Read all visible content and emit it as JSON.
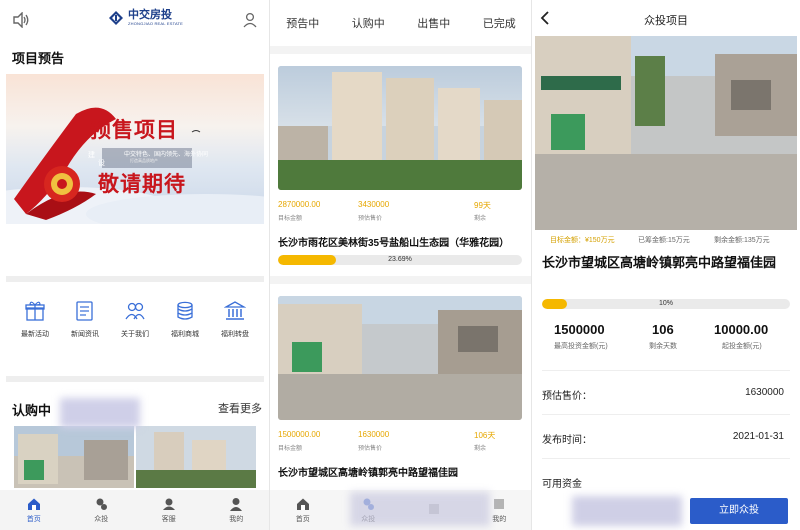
{
  "panel_home": {
    "logo": {
      "name_cn": "中交房投",
      "name_en": "ZHONGJIAO REAL ESTATE"
    },
    "section_preview_title": "项目预告",
    "banner": {
      "headline1": "预售项目",
      "headline2": "敬请期待",
      "badge1": "建",
      "badge2": "设",
      "strip_text": "中交特色、国内领先、海外协同",
      "strip_sub": "打造高品质地产"
    },
    "menu": [
      {
        "label": "最新活动",
        "icon": "gift-icon"
      },
      {
        "label": "新闻资讯",
        "icon": "news-icon"
      },
      {
        "label": "关于我们",
        "icon": "people-icon"
      },
      {
        "label": "福利商城",
        "icon": "coins-icon"
      },
      {
        "label": "福利转盘",
        "icon": "bank-icon"
      }
    ],
    "section_subscribing_title": "认购中",
    "more_label": "查看更多",
    "tabbar": [
      {
        "label": "首页",
        "icon": "home-icon",
        "active": true
      },
      {
        "label": "众投",
        "icon": "invest-icon",
        "active": false
      },
      {
        "label": "客服",
        "icon": "service-icon",
        "active": false
      },
      {
        "label": "我的",
        "icon": "profile-icon",
        "active": false
      }
    ]
  },
  "panel_list": {
    "tabs": [
      "预告中",
      "认购中",
      "出售中",
      "已完成"
    ],
    "cards": [
      {
        "target_amount": "2870000.00",
        "target_label": "目标金额",
        "est_price": "3430000",
        "est_label": "预估售价",
        "days": "99天",
        "days_label": "剩余",
        "title": "长沙市雨花区美林街35号盐船山生态园（华雅花园）",
        "progress_text": "23.69%",
        "progress_value": 0.2369
      },
      {
        "target_amount": "1500000.00",
        "target_label": "目标金额",
        "est_price": "1630000",
        "est_label": "预估售价",
        "days": "106天",
        "days_label": "剩余",
        "title": "长沙市望城区高塘岭镇郭亮中路望福佳园"
      }
    ],
    "tabbar": [
      {
        "label": "首页",
        "icon": "home-icon"
      },
      {
        "label": "众投",
        "icon": "invest-icon"
      },
      {
        "label": "",
        "icon": "service-icon"
      },
      {
        "label": "我的",
        "icon": "profile-icon"
      }
    ]
  },
  "panel_detail": {
    "header_title": "众投项目",
    "target_text": "目标金额：¥150万元",
    "raised_text": "已筹金额:15万元",
    "remaining_text": "剩余金额:135万元",
    "title": "长沙市望城区高塘岭镇郭亮中路望福佳园",
    "progress_text": "10%",
    "progress_value": 0.1,
    "stats": [
      {
        "value": "1500000",
        "label": "最高投资金额(元)"
      },
      {
        "value": "106",
        "label": "剩余天数"
      },
      {
        "value": "10000.00",
        "label": "起投金额(元)"
      }
    ],
    "rows": [
      {
        "label": "预估售价：",
        "value": "1630000"
      },
      {
        "label": "发布时间：",
        "value": "2021-01-31"
      },
      {
        "label": "可用资金",
        "value": ""
      }
    ],
    "cta_label": "立即众投",
    "colors": {
      "accent": "#2b5cc9",
      "progress": "#f5b800",
      "highlight": "#e6a700"
    }
  }
}
